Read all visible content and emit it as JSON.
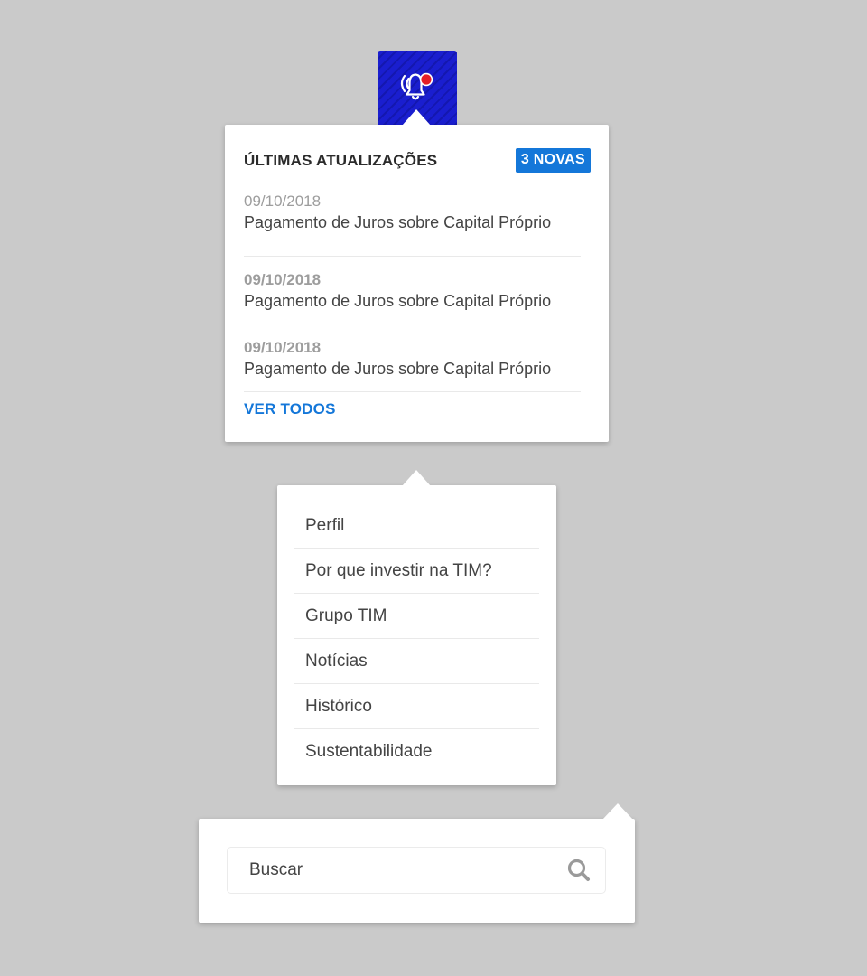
{
  "colors": {
    "background": "#cacaca",
    "bell_button": "#1a1ecf",
    "notification_dot": "#e41e26",
    "accent_blue": "#1477d9",
    "muted_date": "#9d9d9d",
    "text": "#444444"
  },
  "bell": {
    "icon": "ringing-bell-icon",
    "has_unread": true
  },
  "notifications": {
    "title": "ÚLTIMAS ATUALIZAÇÕES",
    "badge": "3 NOVAS",
    "items": [
      {
        "date": "09/10/2018",
        "text": "Pagamento de Juros sobre Capital Próprio"
      },
      {
        "date": "09/10/2018",
        "text": "Pagamento de Juros sobre Capital Próprio"
      },
      {
        "date": "09/10/2018",
        "text": "Pagamento de Juros sobre Capital Próprio"
      }
    ],
    "see_all": "VER TODOS"
  },
  "menu": {
    "items": [
      {
        "label": "Perfil"
      },
      {
        "label": "Por que investir na TIM?"
      },
      {
        "label": "Grupo TIM"
      },
      {
        "label": "Notícias"
      },
      {
        "label": "Histórico"
      },
      {
        "label": "Sustentabilidade"
      }
    ]
  },
  "search": {
    "placeholder": "Buscar",
    "icon": "search-icon"
  }
}
